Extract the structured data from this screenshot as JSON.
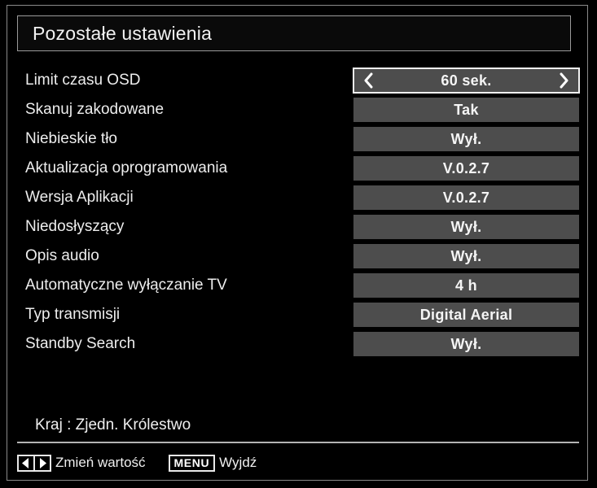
{
  "screen": {
    "title": "Pozostałe ustawienia",
    "background_color": "#000000",
    "frame_border_color": "#8a8a8a",
    "value_box_color": "#4d4d4d",
    "highlight_border_color": "#f2f2f2",
    "text_color": "#ededed"
  },
  "settings": {
    "rows": [
      {
        "label": "Limit czasu OSD",
        "value": "60 sek.",
        "selected": true
      },
      {
        "label": "Skanuj zakodowane",
        "value": "Tak",
        "selected": false
      },
      {
        "label": "Niebieskie tło",
        "value": "Wył.",
        "selected": false
      },
      {
        "label": "Aktualizacja oprogramowania",
        "value": "V.0.2.7",
        "selected": false
      },
      {
        "label": "Wersja Aplikacji",
        "value": "V.0.2.7",
        "selected": false
      },
      {
        "label": "Niedosłyszący",
        "value": "Wył.",
        "selected": false
      },
      {
        "label": "Opis audio",
        "value": "Wył.",
        "selected": false
      },
      {
        "label": "Automatyczne wyłączanie TV",
        "value": "4 h",
        "selected": false
      },
      {
        "label": "Typ transmisji",
        "value": "Digital Aerial",
        "selected": false
      },
      {
        "label": "Standby Search",
        "value": "Wył.",
        "selected": false
      }
    ],
    "left_chevron_icon": "chevron-left-icon",
    "right_chevron_icon": "chevron-right-icon"
  },
  "country": {
    "text": "Kraj : Zjedn. Królestwo"
  },
  "footer": {
    "hints": [
      {
        "key_type": "arrow-keys",
        "key_label": "",
        "action": "Zmień wartość"
      },
      {
        "key_type": "menu-key",
        "key_label": "MENU",
        "action": "Wyjdź"
      }
    ]
  }
}
